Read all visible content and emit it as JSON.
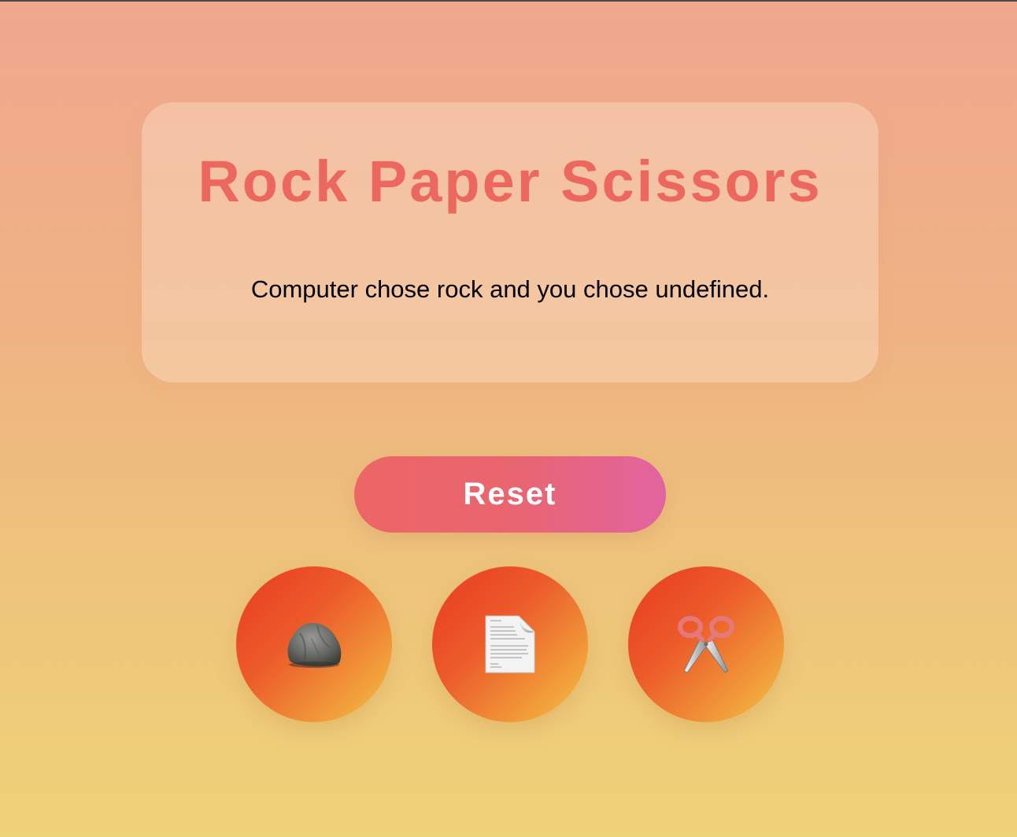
{
  "title": "Rock Paper Scissors",
  "result_text": "Computer chose rock and you chose undefined.",
  "reset_label": "Reset",
  "choices": [
    {
      "name": "rock",
      "icon": "rock-icon"
    },
    {
      "name": "paper",
      "icon": "paper-icon"
    },
    {
      "name": "scissors",
      "icon": "scissors-icon"
    }
  ],
  "colors": {
    "title": "#ec675d",
    "reset_start": "#ed6666",
    "reset_end": "#e264a0",
    "choice_start": "#e93b22",
    "choice_end": "#f6c344",
    "background_top": "#f0a78e",
    "background_bottom": "#efd378"
  }
}
